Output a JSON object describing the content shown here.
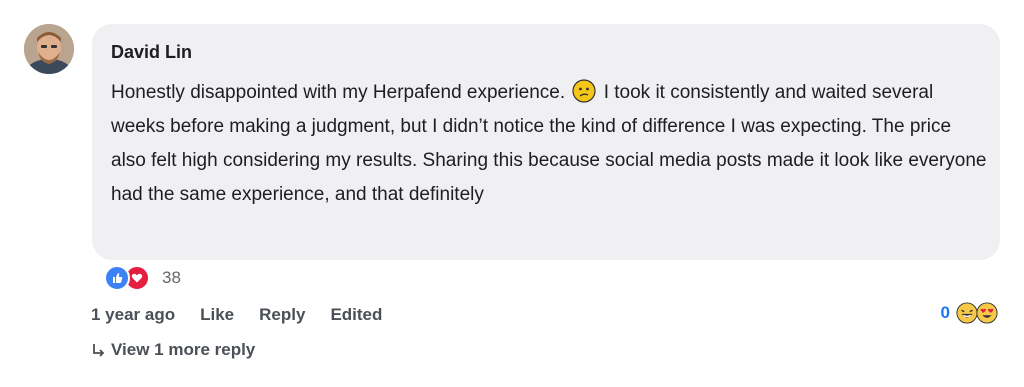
{
  "comment": {
    "author": "David Lin",
    "text_before_emoji": "Honestly disappointed with my Herpafend experience.",
    "emoji": "confused-face",
    "text_after_emoji": " I took it consistently and waited several weeks before making a judgment, but I didn’t notice the kind of difference I was expecting. The price also felt high considering my results. Sharing this because social media posts made it look like everyone had the same experience, and that definitely",
    "reactions": {
      "icons": [
        "thumbs-up-icon",
        "heart-icon"
      ],
      "count": "38"
    },
    "actions": {
      "time": "1 year ago",
      "like": "Like",
      "reply": "Reply",
      "edited": "Edited"
    },
    "right_reactions": {
      "count": "0",
      "icons": [
        "laughing-face-icon",
        "heart-eyes-face-icon"
      ]
    },
    "view_more": "View 1 more reply"
  },
  "colors": {
    "bubble": "#f0f0f2",
    "link_blue": "#1877f2",
    "like_blue": "#3b82f6",
    "love_red": "#e41e3f"
  }
}
